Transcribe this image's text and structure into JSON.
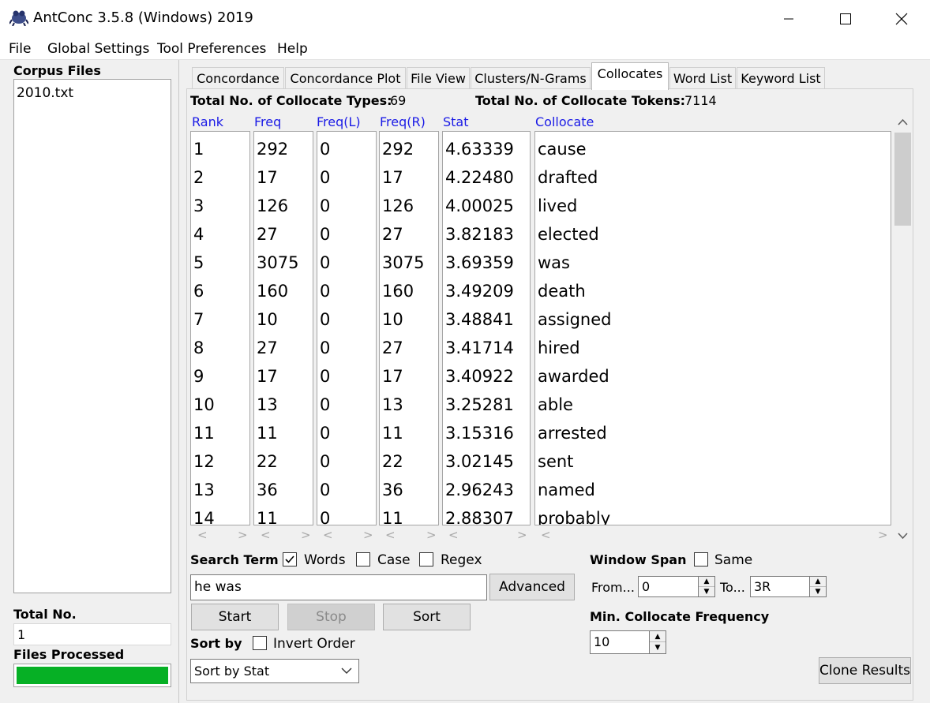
{
  "window": {
    "title": "AntConc 3.5.8 (Windows) 2019"
  },
  "menu": [
    "File",
    "Global Settings",
    "Tool Preferences",
    "Help"
  ],
  "corpus": {
    "label": "Corpus Files",
    "files": [
      "2010.txt"
    ],
    "total_label": "Total No.",
    "total_value": "1",
    "processed_label": "Files Processed",
    "progress": 1.0
  },
  "tabs": [
    "Concordance",
    "Concordance Plot",
    "File View",
    "Clusters/N-Grams",
    "Collocates",
    "Word List",
    "Keyword List"
  ],
  "active_tab": "Collocates",
  "summary": {
    "types_label": "Total No. of Collocate Types:",
    "types_value": "69",
    "tokens_label": "Total No. of Collocate Tokens:",
    "tokens_value": "7114"
  },
  "columns": [
    "Rank",
    "Freq",
    "Freq(L)",
    "Freq(R)",
    "Stat",
    "Collocate"
  ],
  "rows": [
    [
      "1",
      "292",
      "0",
      "292",
      "4.63339",
      "cause"
    ],
    [
      "2",
      "17",
      "0",
      "17",
      "4.22480",
      "drafted"
    ],
    [
      "3",
      "126",
      "0",
      "126",
      "4.00025",
      "lived"
    ],
    [
      "4",
      "27",
      "0",
      "27",
      "3.82183",
      "elected"
    ],
    [
      "5",
      "3075",
      "0",
      "3075",
      "3.69359",
      "was"
    ],
    [
      "6",
      "160",
      "0",
      "160",
      "3.49209",
      "death"
    ],
    [
      "7",
      "10",
      "0",
      "10",
      "3.48841",
      "assigned"
    ],
    [
      "8",
      "27",
      "0",
      "27",
      "3.41714",
      "hired"
    ],
    [
      "9",
      "17",
      "0",
      "17",
      "3.40922",
      "awarded"
    ],
    [
      "10",
      "13",
      "0",
      "13",
      "3.25281",
      "able"
    ],
    [
      "11",
      "11",
      "0",
      "11",
      "3.15316",
      "arrested"
    ],
    [
      "12",
      "22",
      "0",
      "22",
      "3.02145",
      "sent"
    ],
    [
      "13",
      "36",
      "0",
      "36",
      "2.96243",
      "named"
    ],
    [
      "14",
      "11",
      "0",
      "11",
      "2.88307",
      "probably"
    ]
  ],
  "search": {
    "label": "Search Term",
    "words_label": "Words",
    "words_checked": true,
    "case_label": "Case",
    "case_checked": false,
    "regex_label": "Regex",
    "regex_checked": false,
    "value": "he was",
    "advanced_label": "Advanced",
    "start_label": "Start",
    "stop_label": "Stop",
    "sort_label": "Sort"
  },
  "sort": {
    "label": "Sort by",
    "invert_label": "Invert Order",
    "invert_checked": false,
    "selected": "Sort by Stat"
  },
  "window_span": {
    "label": "Window Span",
    "same_label": "Same",
    "same_checked": false,
    "from_label": "From...",
    "from_value": "0",
    "to_label": "To...",
    "to_value": "3R"
  },
  "min_freq": {
    "label": "Min. Collocate Frequency",
    "value": "10"
  },
  "clone_label": "Clone Results"
}
